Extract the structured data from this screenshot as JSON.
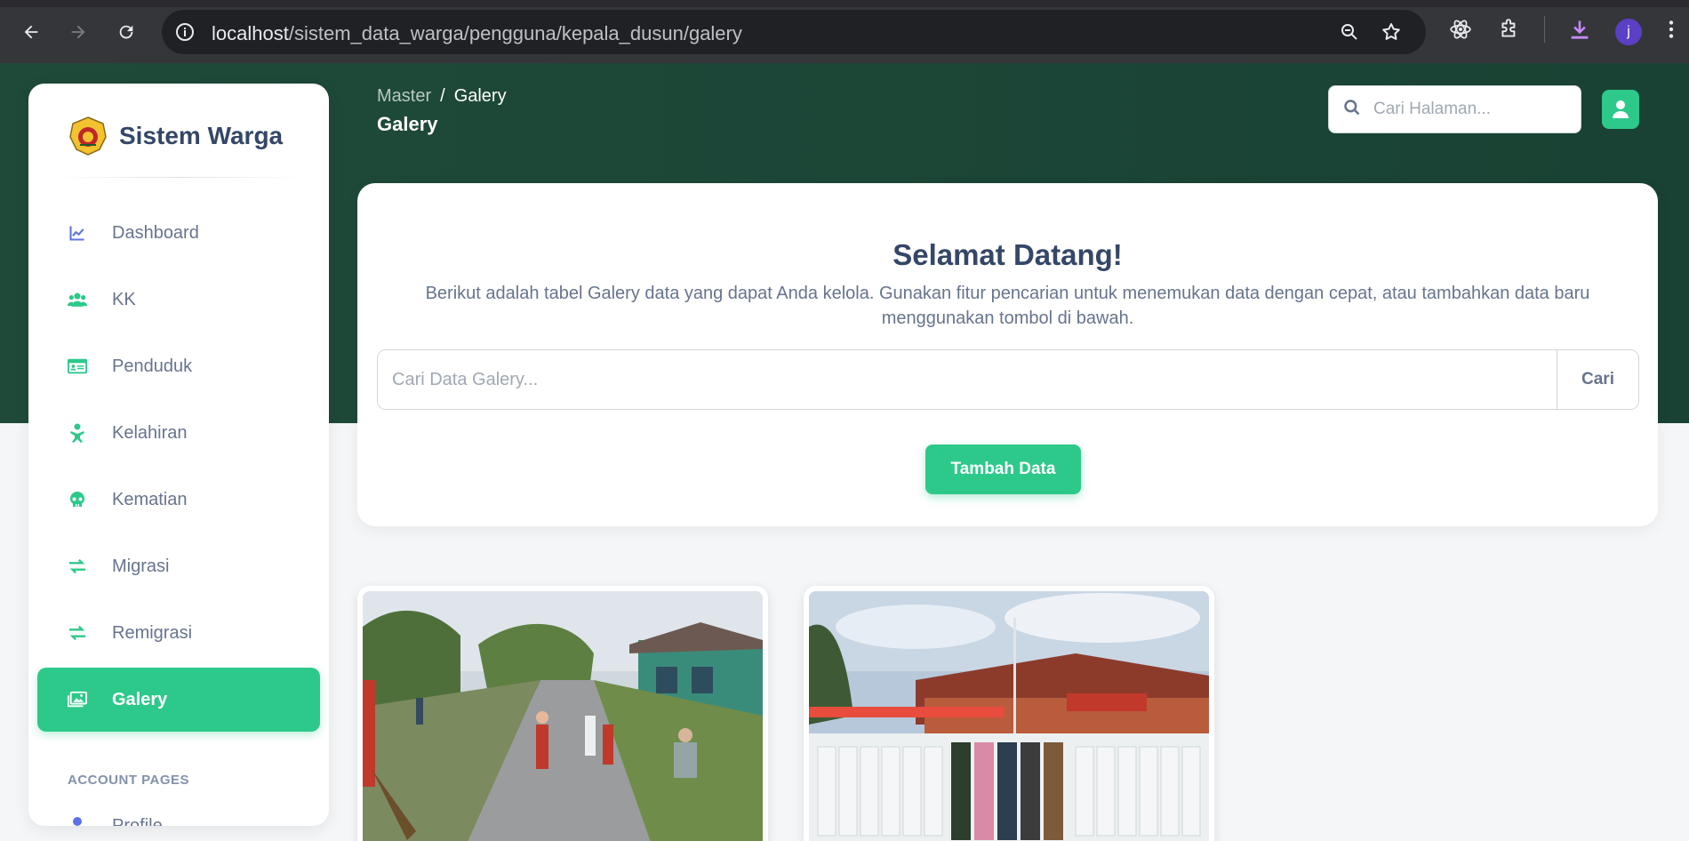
{
  "browser": {
    "url_host": "localhost",
    "url_path": "/sistem_data_warga/pengguna/kepala_dusun/galery",
    "profile_initial": "j"
  },
  "sidebar": {
    "brand": "Sistem Warga",
    "items": [
      {
        "label": "Dashboard",
        "icon": "chart-line-icon",
        "active": false
      },
      {
        "label": "KK",
        "icon": "users-icon",
        "active": false
      },
      {
        "label": "Penduduk",
        "icon": "id-card-icon",
        "active": false
      },
      {
        "label": "Kelahiran",
        "icon": "baby-icon",
        "active": false
      },
      {
        "label": "Kematian",
        "icon": "skull-icon",
        "active": false
      },
      {
        "label": "Migrasi",
        "icon": "exchange-icon",
        "active": false
      },
      {
        "label": "Remigrasi",
        "icon": "exchange-icon",
        "active": false
      },
      {
        "label": "Galery",
        "icon": "images-icon",
        "active": true
      }
    ],
    "section_label": "ACCOUNT PAGES",
    "profile_label": "Profile"
  },
  "header": {
    "breadcrumb_parent": "Master",
    "breadcrumb_sep": "/",
    "breadcrumb_current": "Galery",
    "title": "Galery",
    "search_placeholder": "Cari Halaman..."
  },
  "welcome": {
    "title": "Selamat Datang!",
    "description": "Berikut adalah tabel Galery data yang dapat Anda kelola. Gunakan fitur pencarian untuk menemukan data dengan cepat, atau tambahkan data baru menggunakan tombol di bawah.",
    "search_placeholder": "Cari Data Galery...",
    "search_button": "Cari",
    "add_button": "Tambah Data"
  },
  "gallery": [
    {
      "alt": "street-cleaning-photo"
    },
    {
      "alt": "ceremony-group-photo"
    }
  ],
  "colors": {
    "accent": "#2dc98a",
    "hero": "#1d4737",
    "text_dark": "#344767",
    "text_muted": "#67748e"
  }
}
